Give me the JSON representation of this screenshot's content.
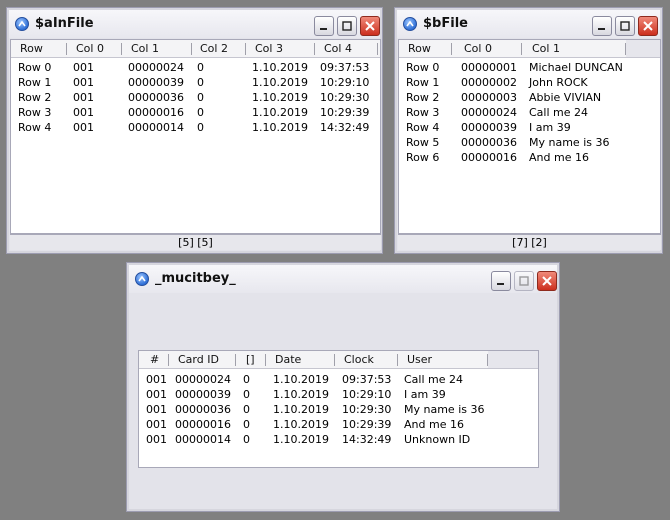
{
  "windows": {
    "ainfile": {
      "title": "$aInFile",
      "columns": [
        "Row",
        "Col 0",
        "Col 1",
        "Col 2",
        "Col 3",
        "Col 4"
      ],
      "rows": [
        [
          "Row 0",
          "001",
          "00000024",
          "0",
          "1.10.2019",
          "09:37:53"
        ],
        [
          "Row 1",
          "001",
          "00000039",
          "0",
          "1.10.2019",
          "10:29:10"
        ],
        [
          "Row 2",
          "001",
          "00000036",
          "0",
          "1.10.2019",
          "10:29:30"
        ],
        [
          "Row 3",
          "001",
          "00000016",
          "0",
          "1.10.2019",
          "10:29:39"
        ],
        [
          "Row 4",
          "001",
          "00000014",
          "0",
          "1.10.2019",
          "14:32:49"
        ]
      ],
      "status": "[5] [5]"
    },
    "bfile": {
      "title": "$bFile",
      "columns": [
        "Row",
        "Col 0",
        "Col 1"
      ],
      "rows": [
        [
          "Row 0",
          "00000001",
          "Michael DUNCAN"
        ],
        [
          "Row 1",
          "00000002",
          "John ROCK"
        ],
        [
          "Row 2",
          "00000003",
          "Abbie VIVIAN"
        ],
        [
          "Row 3",
          "00000024",
          "Call me 24"
        ],
        [
          "Row 4",
          "00000039",
          "I am 39"
        ],
        [
          "Row 5",
          "00000036",
          "My name is 36"
        ],
        [
          "Row 6",
          "00000016",
          "And me 16"
        ]
      ],
      "status": "[7] [2]"
    },
    "mucitbey": {
      "title": "_mucitbey_",
      "columns": [
        "#",
        "Card ID",
        "[]",
        "Date",
        "Clock",
        "User"
      ],
      "rows": [
        [
          "001",
          "00000024",
          "0",
          "1.10.2019",
          "09:37:53",
          "Call me 24"
        ],
        [
          "001",
          "00000039",
          "0",
          "1.10.2019",
          "10:29:10",
          "I am 39"
        ],
        [
          "001",
          "00000036",
          "0",
          "1.10.2019",
          "10:29:30",
          "My name is 36"
        ],
        [
          "001",
          "00000016",
          "0",
          "1.10.2019",
          "10:29:39",
          "And me 16"
        ],
        [
          "001",
          "00000014",
          "0",
          "1.10.2019",
          "14:32:49",
          "Unknown ID"
        ]
      ]
    }
  },
  "icons": {
    "app": "app-logo-icon",
    "minimize": "minimize-icon",
    "maximize": "maximize-icon",
    "close": "close-icon"
  },
  "colors": {
    "window_bg": "#e3e3ea",
    "close_button": "#cc2f1e",
    "grid_bg": "#ffffff"
  }
}
